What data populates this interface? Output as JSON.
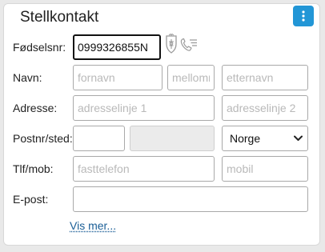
{
  "card": {
    "title": "Stellkontakt",
    "menu_icon": "kebab-vertical-icon"
  },
  "fields": {
    "fodselsnr": {
      "label": "Fødselsnr:",
      "value": "0999326855N"
    },
    "navn": {
      "label": "Navn:",
      "fornavn_placeholder": "fornavn",
      "mellomnavn_placeholder": "mellomnavn",
      "etternavn_placeholder": "etternavn"
    },
    "adresse": {
      "label": "Adresse:",
      "linje1_placeholder": "adresselinje 1",
      "linje2_placeholder": "adresselinje 2"
    },
    "postnr": {
      "label": "Postnr/sted:",
      "postnr_value": "",
      "sted_value": "",
      "land_selected": "Norge"
    },
    "tlf": {
      "label": "Tlf/mob:",
      "fasttelefon_placeholder": "fasttelefon",
      "mobil_placeholder": "mobil"
    },
    "epost": {
      "label": "E-post:",
      "value": ""
    }
  },
  "icons": {
    "registry": "coat-of-arms-icon",
    "phone_list": "phone-list-icon"
  },
  "links": {
    "vis_mer": "Vis mer..."
  }
}
